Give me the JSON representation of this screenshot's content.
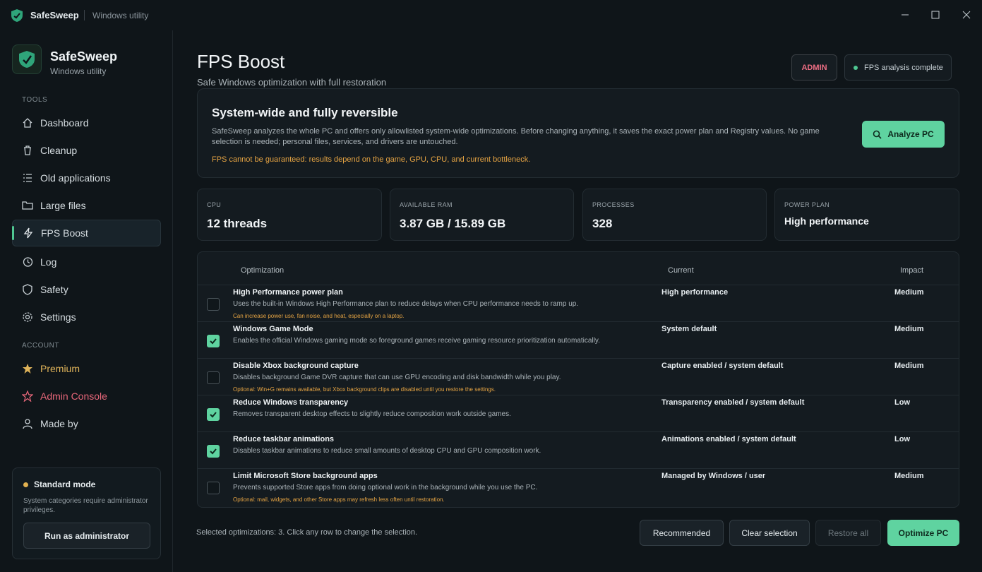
{
  "window": {
    "app_name": "SafeSweep",
    "subtitle": "Windows utility"
  },
  "sidebar": {
    "brand_name": "SafeSweep",
    "brand_sub": "Windows utility",
    "tools_label": "TOOLS",
    "account_label": "ACCOUNT",
    "tools": [
      {
        "label": "Dashboard",
        "icon": "home-icon"
      },
      {
        "label": "Cleanup",
        "icon": "trash-icon"
      },
      {
        "label": "Old applications",
        "icon": "list-icon"
      },
      {
        "label": "Large files",
        "icon": "folder-icon"
      },
      {
        "label": "FPS Boost",
        "icon": "bolt-icon",
        "active": true
      },
      {
        "label": "Log",
        "icon": "history-icon"
      },
      {
        "label": "Safety",
        "icon": "shield-icon"
      },
      {
        "label": "Settings",
        "icon": "gear-icon"
      }
    ],
    "account": [
      {
        "label": "Premium",
        "icon": "star-icon"
      },
      {
        "label": "Admin Console",
        "icon": "star-outline-icon"
      },
      {
        "label": "Made by",
        "icon": "user-icon"
      }
    ],
    "mode": {
      "title": "Standard mode",
      "desc": "System categories require administrator privileges.",
      "button": "Run as administrator"
    }
  },
  "header": {
    "title": "FPS Boost",
    "subtitle": "Safe Windows optimization with full restoration",
    "admin_badge": "ADMIN",
    "status": "FPS analysis complete"
  },
  "hero": {
    "title": "System-wide and fully reversible",
    "desc": "SafeSweep analyzes the whole PC and offers only allowlisted system-wide optimizations. Before changing anything, it saves the exact power plan and Registry values. No game selection is needed; personal files, services, and drivers are untouched.",
    "warning": "FPS cannot be guaranteed: results depend on the game, GPU, CPU, and current bottleneck.",
    "button": "Analyze PC"
  },
  "stats": [
    {
      "label": "CPU",
      "value": "12 threads"
    },
    {
      "label": "AVAILABLE RAM",
      "value": "3.87 GB / 15.89 GB"
    },
    {
      "label": "PROCESSES",
      "value": "328"
    },
    {
      "label": "POWER PLAN",
      "value": "High performance"
    }
  ],
  "table": {
    "headers": {
      "optimization": "Optimization",
      "current": "Current",
      "impact": "Impact"
    },
    "rows": [
      {
        "name": "High Performance power plan",
        "desc": "Uses the built-in Windows High Performance plan to reduce delays when CPU performance needs to ramp up.",
        "warning": "Can increase power use, fan noise, and heat, especially on a laptop.",
        "current": "High performance",
        "impact": "Medium",
        "checked": false
      },
      {
        "name": "Windows Game Mode",
        "desc": "Enables the official Windows gaming mode so foreground games receive gaming resource prioritization automatically.",
        "warning": "",
        "current": "System default",
        "impact": "Medium",
        "checked": true
      },
      {
        "name": "Disable Xbox background capture",
        "desc": "Disables background Game DVR capture that can use GPU encoding and disk bandwidth while you play.",
        "warning": "Optional: Win+G remains available, but Xbox background clips are disabled until you restore the settings.",
        "current": "Capture enabled / system default",
        "impact": "Medium",
        "checked": false
      },
      {
        "name": "Reduce Windows transparency",
        "desc": "Removes transparent desktop effects to slightly reduce composition work outside games.",
        "warning": "",
        "current": "Transparency enabled / system default",
        "impact": "Low",
        "checked": true
      },
      {
        "name": "Reduce taskbar animations",
        "desc": "Disables taskbar animations to reduce small amounts of desktop CPU and GPU composition work.",
        "warning": "",
        "current": "Animations enabled / system default",
        "impact": "Low",
        "checked": true
      },
      {
        "name": "Limit Microsoft Store background apps",
        "desc": "Prevents supported Store apps from doing optional work in the background while you use the PC.",
        "warning": "Optional: mail, widgets, and other Store apps may refresh less often until restoration.",
        "current": "Managed by Windows / user",
        "impact": "Medium",
        "checked": false
      }
    ]
  },
  "footer": {
    "selection_text": "Selected optimizations: 3. Click any row to change the selection.",
    "recommended": "Recommended",
    "clear": "Clear selection",
    "restore": "Restore all",
    "optimize": "Optimize PC"
  },
  "colors": {
    "accent": "#5fd3a0",
    "warning": "#e6a443",
    "admin": "#ef6e84",
    "premium": "#e0b45a"
  }
}
